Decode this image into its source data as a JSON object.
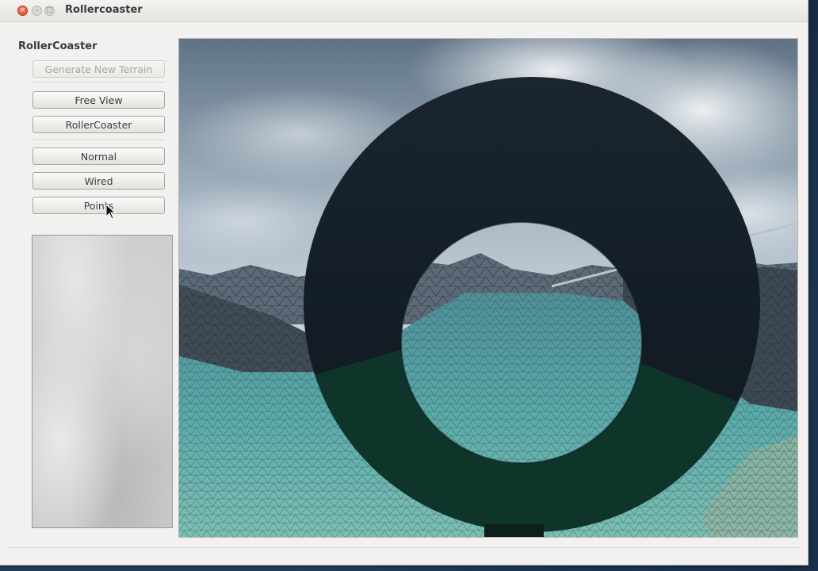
{
  "window": {
    "title": "Rollercoaster"
  },
  "panel": {
    "title": "RollerCoaster",
    "buttons": {
      "generate": "Generate New Terrain",
      "free_view": "Free View",
      "rollercoaster": "RollerCoaster",
      "normal": "Normal",
      "wired": "Wired",
      "points": "Points"
    }
  },
  "icons": {
    "close": "close-icon",
    "minimize": "minimize-icon",
    "maximize": "maximize-icon",
    "cursor": "mouse-pointer-icon"
  },
  "colors": {
    "window_bg": "#f2f1f0",
    "torus": "#18232c",
    "water": "#4fa6a3",
    "sky": "#9fb1c0"
  }
}
